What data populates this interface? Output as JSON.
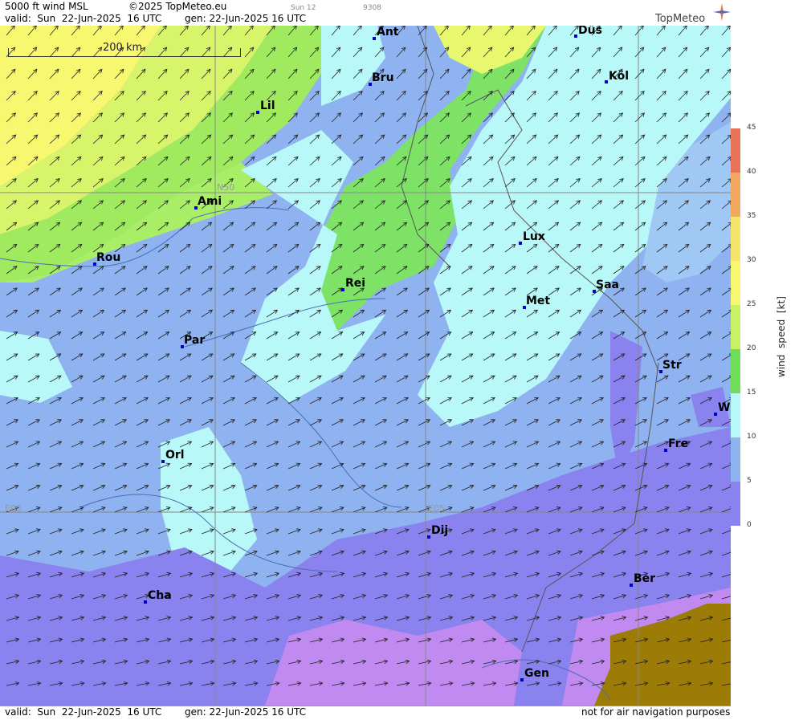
{
  "header": {
    "title": "5000 ft wind MSL",
    "copyright": "©2025 TopMeteo.eu",
    "valid": "valid:  Sun  22-Jun-2025  16 UTC",
    "gen": "gen: 22-Jun-2025 16 UTC",
    "small_sun": "Sun 12",
    "small_code": "9308",
    "logo": "TopMeteo"
  },
  "footer": {
    "valid": "valid:  Sun  22-Jun-2025  16 UTC",
    "gen": "gen: 22-Jun-2025 16 UTC",
    "disclaimer": "not for air navigation purposes"
  },
  "scale": {
    "label": "200 km"
  },
  "grid_labels": {
    "n50": "N50",
    "e00": "E00",
    "e05": "E05"
  },
  "legend": {
    "title": "wind  speed  [kt]",
    "ticks": [
      "45",
      "40",
      "35",
      "30",
      "25",
      "20",
      "15",
      "10",
      "5",
      "0"
    ],
    "colors": [
      "#e8735a",
      "#f2a85e",
      "#f5e46a",
      "#f7f870",
      "#c8f264",
      "#6ede5a",
      "#b8f8f8",
      "#8fb2f0",
      "#8a82ee",
      "#c08af0"
    ]
  },
  "cities": [
    {
      "name": "Ant"
    },
    {
      "name": "Düs"
    },
    {
      "name": "Bru"
    },
    {
      "name": "Köl"
    },
    {
      "name": "Lil"
    },
    {
      "name": "Ami"
    },
    {
      "name": "Rou"
    },
    {
      "name": "Lux"
    },
    {
      "name": "Rei"
    },
    {
      "name": "Saa"
    },
    {
      "name": "Met"
    },
    {
      "name": "Par"
    },
    {
      "name": "Str"
    },
    {
      "name": "W"
    },
    {
      "name": "Fre"
    },
    {
      "name": "Orl"
    },
    {
      "name": "Dij"
    },
    {
      "name": "Ber"
    },
    {
      "name": "Cha"
    },
    {
      "name": "Gen"
    }
  ]
}
